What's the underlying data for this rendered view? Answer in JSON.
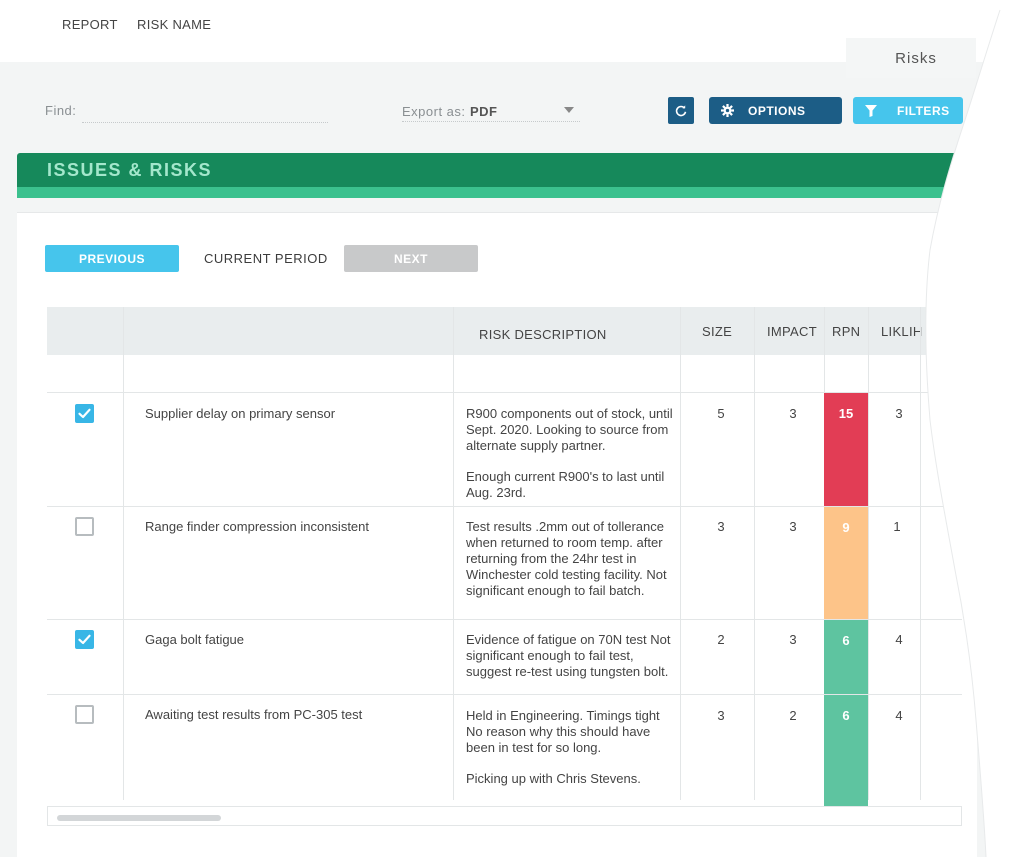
{
  "tab": {
    "label": "Risks"
  },
  "toolbar": {
    "find_label": "Find:",
    "find_value": "",
    "export_label": "Export as:",
    "export_value": "PDF",
    "options_label": "OPTIONS",
    "filters_label": "FILTERS"
  },
  "section": {
    "title": "ISSUES & RISKS"
  },
  "period": {
    "previous_label": "PREVIOUS",
    "current_label": "CURRENT PERIOD",
    "next_label": "NEXT"
  },
  "table": {
    "columns": [
      "REPORT",
      "RISK NAME",
      "RISK DESCRIPTION",
      "SIZE",
      "IMPACT",
      "RPN",
      "LIKLIH"
    ],
    "rows": [
      {
        "report": true,
        "name": "Supplier delay on primary sensor",
        "description": [
          "R900 components out of stock, until Sept. 2020. Looking to source from alternate supply partner.",
          "Enough current R900's to last until Aug. 23rd."
        ],
        "size": "5",
        "impact": "3",
        "rpn": "15",
        "rpn_color": "#e23d55",
        "likelihood": "3"
      },
      {
        "report": false,
        "name": "Range finder compression inconsistent",
        "description": [
          "Test results .2mm out of tollerance when returned to room temp. after returning from the 24hr test in Winchester cold testing facility. Not significant enough to fail batch."
        ],
        "size": "3",
        "impact": "3",
        "rpn": "9",
        "rpn_color": "#fdc489",
        "likelihood": "1"
      },
      {
        "report": true,
        "name": "Gaga bolt fatigue",
        "description": [
          "Evidence of fatigue on 70N test Not significant enough to fail test, suggest re-test using tungsten bolt."
        ],
        "size": "2",
        "impact": "3",
        "rpn": "6",
        "rpn_color": "#5ec4a0",
        "likelihood": "4"
      },
      {
        "report": false,
        "name": "Awaiting test results from PC-305 test",
        "description": [
          "Held in Engineering. Timings tight No reason why this should have been in test for so long.",
          "Picking up with Chris Stevens."
        ],
        "size": "3",
        "impact": "2",
        "rpn": "6",
        "rpn_color": "#5ec4a0",
        "likelihood": "4"
      }
    ]
  },
  "colors": {
    "header_green": "#16895b",
    "header_stripe": "#3bc18e",
    "primary_blue": "#1c5d86",
    "accent_blue": "#46c5ec"
  },
  "icons": {
    "refresh": "refresh-icon",
    "options": "gear-icon",
    "filters": "filter-icon",
    "dropdown": "chevron-down-icon",
    "checkbox_checked": "checkmark-icon"
  }
}
